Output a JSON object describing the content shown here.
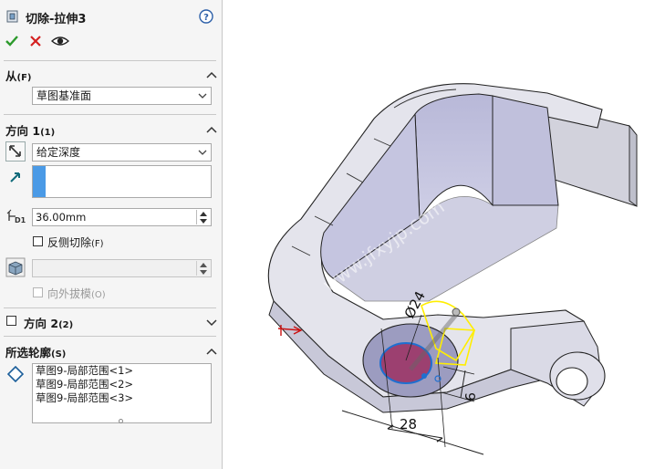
{
  "header": {
    "title": "切除-拉伸3",
    "help_icon": "help-icon",
    "ok_icon": "checkmark-icon",
    "cancel_icon": "x-icon",
    "preview_icon": "eye-icon"
  },
  "from_section": {
    "title": "从",
    "shortcut": "(F)",
    "selected": "草图基准面"
  },
  "direction1": {
    "title": "方向 1",
    "shortcut": "(1)",
    "end_condition": "给定深度",
    "depth_value": "36.00mm",
    "flip_side_label": "反侧切除",
    "flip_side_shortcut": "(F)",
    "draft_outward_label": "向外拔模",
    "draft_outward_shortcut": "(O)"
  },
  "direction2": {
    "title": "方向 2",
    "shortcut": "(2)"
  },
  "profiles": {
    "title": "所选轮廓",
    "shortcut": "(S)",
    "items": [
      "草图9-局部范围<1>",
      "草图9-局部范围<2>",
      "草图9-局部范围<3>"
    ]
  },
  "viewport": {
    "dimension_diameter": "Ø24",
    "dimension_length": "28",
    "dimension_height": "9",
    "watermark": "www.jfxyjp.com"
  },
  "colors": {
    "accept_green": "#2c9a2c",
    "cancel_red": "#d42020",
    "model_face": "#d8d8e4",
    "model_shade": "#9c9cc0",
    "selection_yellow": "#ffee00",
    "cut_profile": "#9c4070"
  }
}
